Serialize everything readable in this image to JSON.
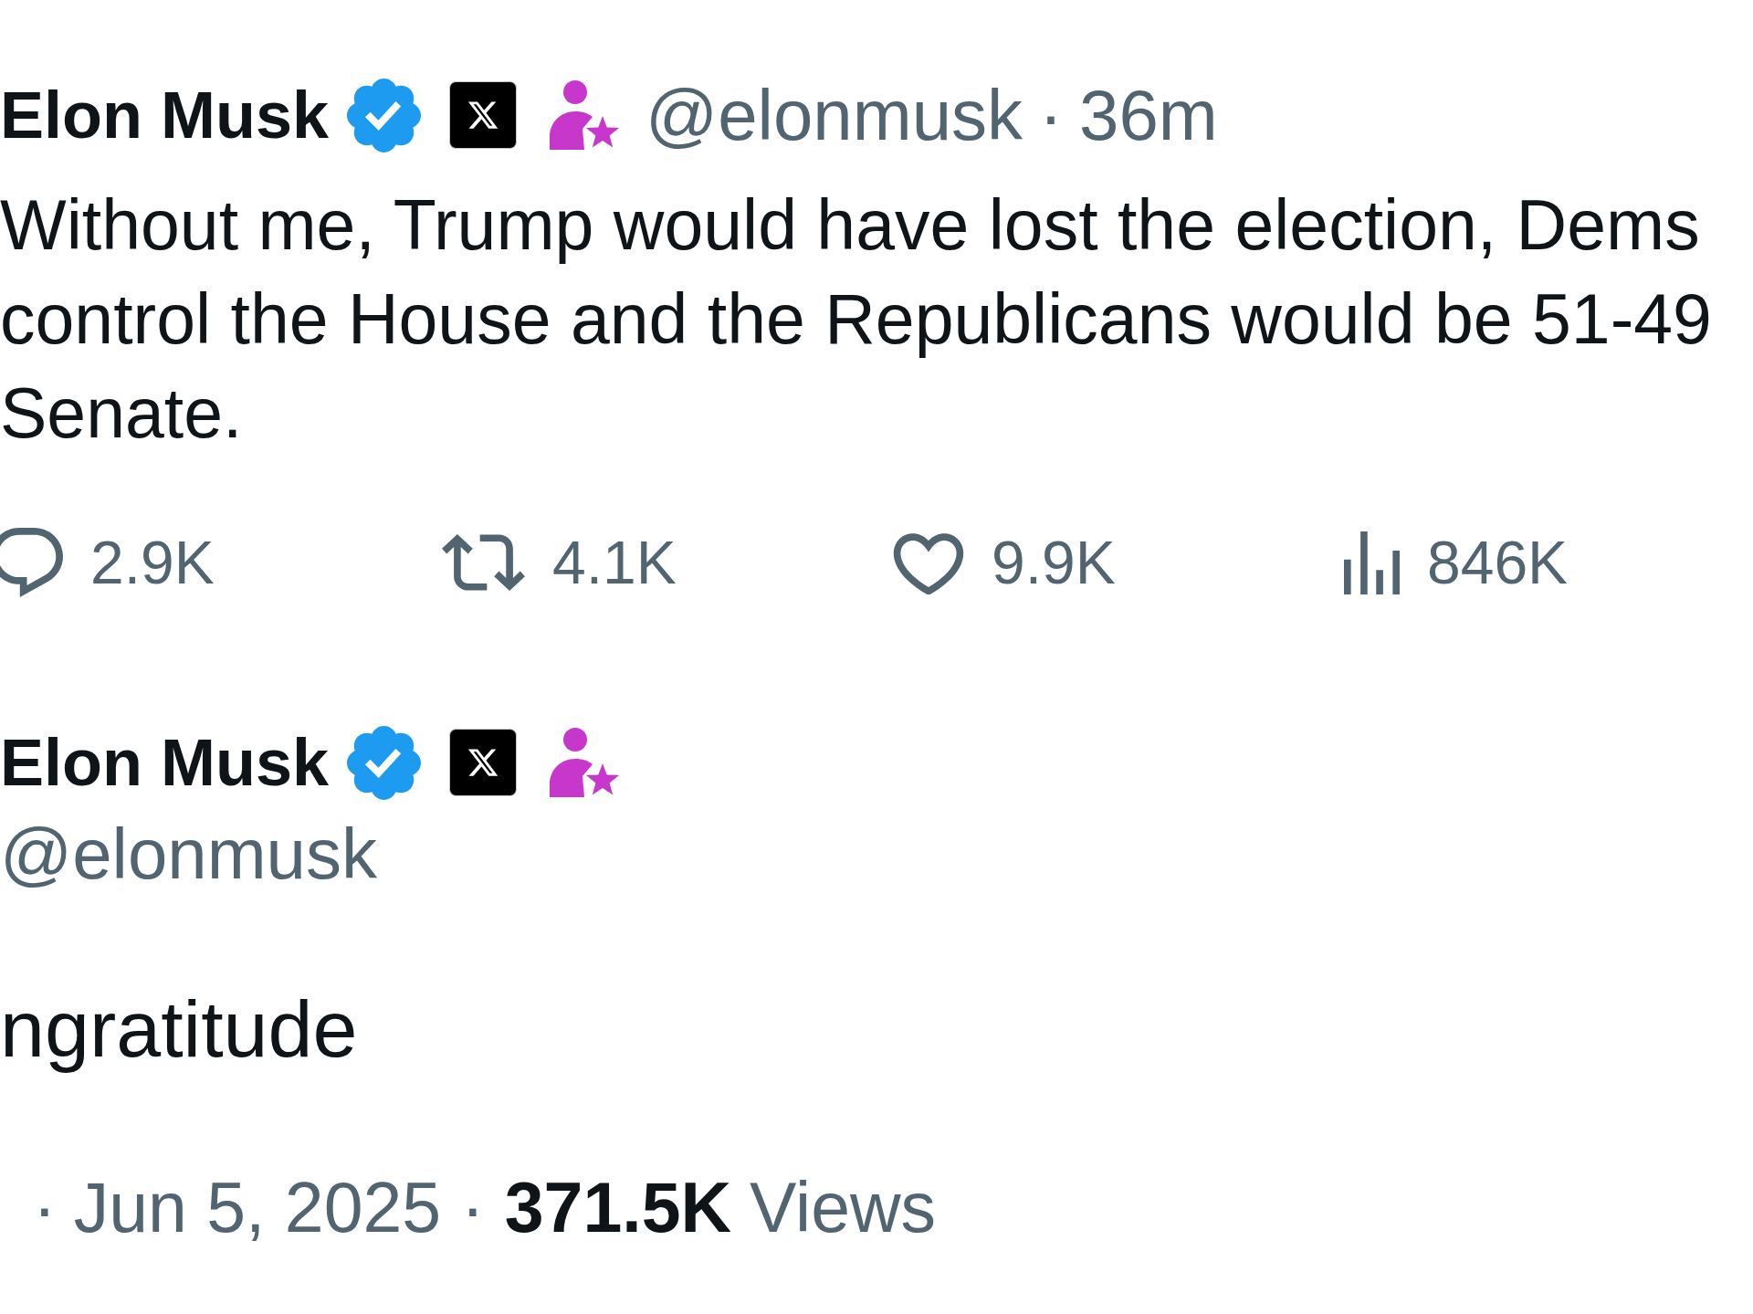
{
  "posts": [
    {
      "kind": "timeline",
      "author": {
        "name": "Elon Musk",
        "handle": "@elonmusk",
        "separator": "·",
        "time": "36m"
      },
      "text_lines": [
        "Without me, Trump would have lost the election, Dems",
        "control the House and the Republicans would be 51-49",
        "Senate."
      ],
      "actions": [
        {
          "kind": "reply",
          "count": "2.9K"
        },
        {
          "kind": "repost",
          "count": "4.1K"
        },
        {
          "kind": "like",
          "count": "9.9K"
        },
        {
          "kind": "views",
          "count": "846K"
        }
      ]
    },
    {
      "kind": "detail",
      "author": {
        "name": "Elon Musk",
        "handle": "@elonmusk"
      },
      "text_lines": [
        "ngratitude"
      ],
      "footer": {
        "lead_separator": "·",
        "date": "Jun 5, 2025",
        "separator": "·",
        "views_count": "371.5K",
        "views_label": "Views"
      }
    }
  ]
}
